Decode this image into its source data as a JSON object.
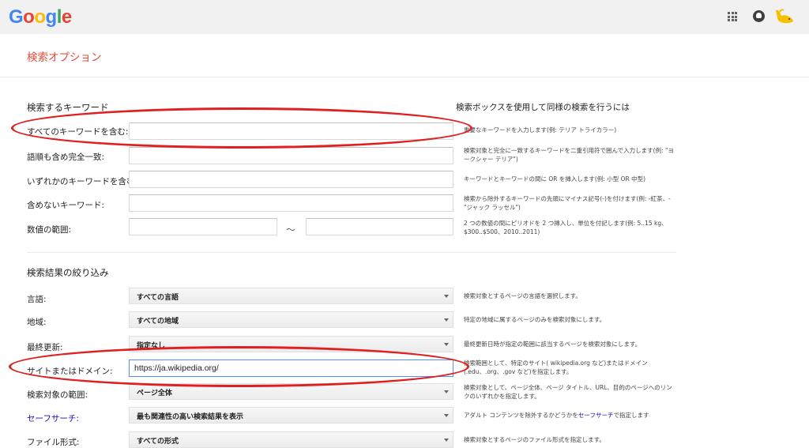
{
  "header": {
    "logo_letters": [
      {
        "ch": "G",
        "color": "#4285f4"
      },
      {
        "ch": "o",
        "color": "#ea4335"
      },
      {
        "ch": "o",
        "color": "#fbbc05"
      },
      {
        "ch": "g",
        "color": "#4285f4"
      },
      {
        "ch": "l",
        "color": "#34a853"
      },
      {
        "ch": "e",
        "color": "#ea4335"
      }
    ],
    "apps_icon": "apps-grid-icon",
    "notifications_icon": "notifications-icon",
    "avatar_icon": "account-avatar"
  },
  "page_title": "検索オプション",
  "keywords": {
    "section_title": "検索するキーワード",
    "help_title": "検索ボックスを使用して同様の検索を行うには",
    "rows": [
      {
        "label": "すべてのキーワードを含む:",
        "value": "",
        "help": "重要なキーワードを入力します(例: テリア トライカラー)"
      },
      {
        "label": "語順も含め完全一致:",
        "value": "",
        "help": "検索対象と完全に一致するキーワードを二重引用符で囲んで入力します(例: \"ヨークシャー テリア\")"
      },
      {
        "label": "いずれかのキーワードを含む:",
        "value": "",
        "help": "キーワードとキーワードの間に OR を挿入します(例: 小型 OR 中型)"
      },
      {
        "label": "含めないキーワード:",
        "value": "",
        "help": "検索から除外するキーワードの先頭にマイナス記号(-)を付けます(例: -紅茶、-\"ジャック ラッセル\")"
      }
    ],
    "range": {
      "label": "数値の範囲:",
      "from": "",
      "to": "",
      "separator": "〜",
      "help": "2 つの数値の間にピリオドを 2 つ挿入し、単位を付記します(例: 5..15 kg、$300..$500、2010..2011)"
    }
  },
  "narrow": {
    "section_title": "検索結果の絞り込み",
    "language": {
      "label": "言語:",
      "value": "すべての言語",
      "help": "検索対象とするページの言語を選択します。"
    },
    "region": {
      "label": "地域:",
      "value": "すべての地域",
      "help": "特定の地域に属するページのみを検索対象にします。"
    },
    "last_update": {
      "label": "最終更新:",
      "value": "指定なし",
      "help": "最終更新日時が指定の範囲に該当するページを検索対象にします。"
    },
    "site": {
      "label": "サイトまたはドメイン:",
      "value": "https://ja.wikipedia.org/",
      "help": "検索範囲として、特定のサイト( wikipedia.org など)またはドメイン(.edu、.org、.gov など)を指定します。"
    },
    "scope": {
      "label": "検索対象の範囲:",
      "value": "ページ全体",
      "help": "検索対象として、ページ全体、ページ タイトル、URL、目的のページへのリンクのいずれかを指定します。"
    },
    "safesearch": {
      "label": "セーフサーチ:",
      "value": "最も関連性の高い検索結果を表示",
      "help_a": "アダルト コンテンツを除外するかどうかを",
      "help_link": "セーフサーチ",
      "help_b": "で指定します"
    },
    "filetype": {
      "label": "ファイル形式:",
      "value": "すべての形式",
      "help": "検索対象とするページのファイル形式を指定します。"
    }
  },
  "annotation_color": "#e02020"
}
